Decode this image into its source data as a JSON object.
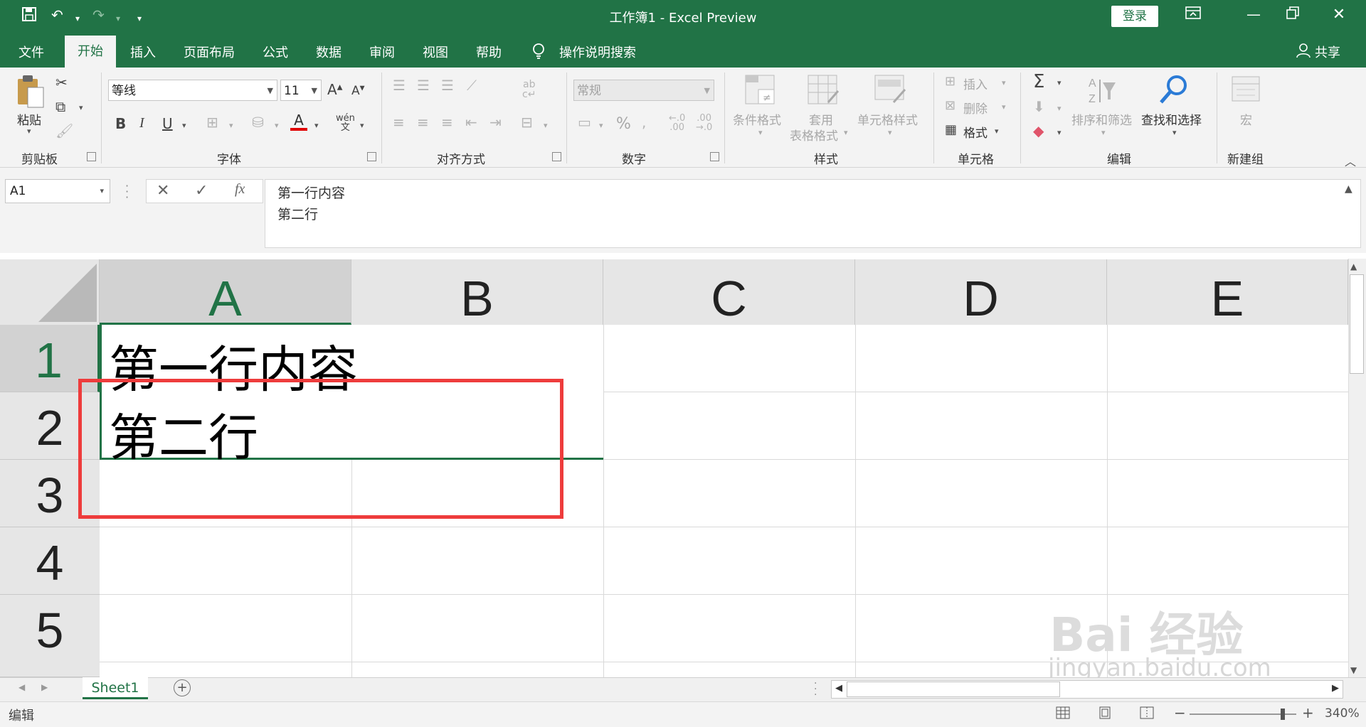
{
  "titlebar": {
    "title": "工作簿1  -  Excel Preview",
    "login_label": "登录",
    "qat": {
      "save_icon": "save-icon",
      "undo_icon": "undo-icon",
      "redo_icon": "redo-icon",
      "customize_icon": "chevron-down-icon"
    }
  },
  "tabs": [
    "文件",
    "开始",
    "插入",
    "页面布局",
    "公式",
    "数据",
    "审阅",
    "视图",
    "帮助"
  ],
  "tell_me": "操作说明搜索",
  "share_label": "共享",
  "ribbon": {
    "clipboard": {
      "paste_label": "粘贴",
      "group_label": "剪贴板"
    },
    "font": {
      "font_name": "等线",
      "font_size": "11",
      "group_label": "字体",
      "font_color": "#e00000"
    },
    "alignment": {
      "group_label": "对齐方式"
    },
    "number": {
      "format_value": "常规",
      "percent": "%",
      "group_label": "数字"
    },
    "styles": {
      "cond_format": "条件格式",
      "table_format_1": "套用",
      "table_format_2": "表格格式",
      "cell_styles": "单元格样式",
      "group_label": "样式"
    },
    "cells": {
      "insert": "插入",
      "delete": "删除",
      "format": "格式",
      "group_label": "单元格"
    },
    "editing": {
      "sort_filter": "排序和筛选",
      "find_select": "查找和选择",
      "group_label": "编辑"
    },
    "newgroup": {
      "macro": "宏",
      "group_label": "新建组"
    }
  },
  "formula_bar": {
    "name_box": "A1",
    "fx": "fx",
    "content_line1": "第一行内容",
    "content_line2": "第二行"
  },
  "grid": {
    "columns": [
      "A",
      "B",
      "C",
      "D",
      "E"
    ],
    "rows": [
      "1",
      "2",
      "3",
      "4",
      "5"
    ],
    "cell_A1_line1": "第一行内容",
    "cell_A1_line2": "第二行"
  },
  "sheet_tab": "Sheet1",
  "status": {
    "mode": "编辑",
    "zoom": "340%"
  },
  "watermark": {
    "line1": "Bai 经验",
    "line2": "jingyan.baidu.com"
  },
  "colors": {
    "accent": "#217346",
    "highlight_box": "#ee3c3c"
  }
}
